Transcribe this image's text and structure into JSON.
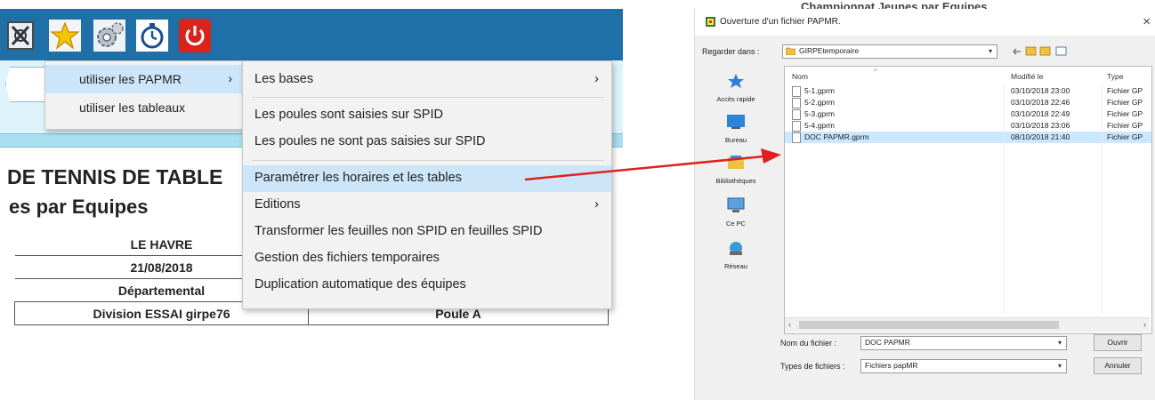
{
  "toolbar": {
    "buttons": [
      {
        "name": "close-x-icon"
      },
      {
        "name": "star-icon"
      },
      {
        "name": "gear-icon"
      },
      {
        "name": "stopwatch-icon"
      },
      {
        "name": "power-icon"
      }
    ],
    "color": "#1f6fa8"
  },
  "document": {
    "title_line1": "DE TENNIS DE TABLE",
    "title_line2": "es par Equipes",
    "rows": [
      {
        "left": "LE HAVRE",
        "right": ""
      },
      {
        "left": "21/08/2018",
        "right": ""
      },
      {
        "left": "Départemental",
        "right": ""
      },
      {
        "left": "Division  ESSAI girpe76",
        "right": "Poule A"
      }
    ]
  },
  "menu1": {
    "items": [
      {
        "label": "utiliser les PAPMR",
        "submenu": "›",
        "highlighted": true
      },
      {
        "label": "utiliser les tableaux",
        "submenu": "",
        "highlighted": false
      }
    ]
  },
  "menu2": {
    "items": [
      {
        "label": "Les bases",
        "submenu": "›"
      },
      {
        "label": "Les poules sont saisies sur SPID",
        "submenu": ""
      },
      {
        "label": "Les poules ne sont pas saisies sur SPID",
        "submenu": ""
      },
      {
        "label": "Paramétrer les horaires et les tables",
        "submenu": "",
        "highlighted": true
      },
      {
        "label": "Editions",
        "submenu": "›"
      },
      {
        "label": "Transformer les feuilles non SPID en feuilles SPID",
        "submenu": ""
      },
      {
        "label": "Gestion des fichiers temporaires",
        "submenu": ""
      },
      {
        "label": "Duplication automatique des équipes",
        "submenu": ""
      }
    ],
    "highlight_color": "#cce5f8"
  },
  "dialog": {
    "background_text": "Championnat  Jeunes par Equipes",
    "title": "Ouverture d'un fichier PAPMR.",
    "close_glyph": "×",
    "look_in_label": "Regarder dans :",
    "look_in_value": "GIRPEtemporaire",
    "places": [
      {
        "label": "Accès rapide",
        "icon": "star-icon"
      },
      {
        "label": "Bureau",
        "icon": "desktop-icon"
      },
      {
        "label": "Bibliothèques",
        "icon": "libraries-icon"
      },
      {
        "label": "Ce PC",
        "icon": "computer-icon"
      },
      {
        "label": "Réseau",
        "icon": "network-icon"
      }
    ],
    "columns": [
      "Nom",
      "Modifié le",
      "Type"
    ],
    "files": [
      {
        "name": "5-1.gprm",
        "modified": "03/10/2018 23:00",
        "type": "Fichier GP",
        "selected": false
      },
      {
        "name": "5-2.gprm",
        "modified": "03/10/2018 22:46",
        "type": "Fichier GP",
        "selected": false
      },
      {
        "name": "5-3.gprm",
        "modified": "03/10/2018 22:49",
        "type": "Fichier GP",
        "selected": false
      },
      {
        "name": "5-4.gprm",
        "modified": "03/10/2018 23:06",
        "type": "Fichier GP",
        "selected": false
      },
      {
        "name": "DOC PAPMR.gprm",
        "modified": "08/10/2018 21:40",
        "type": "Fichier GP",
        "selected": true
      }
    ],
    "filename_label": "Nom du fichier :",
    "filename_value": "DOC PAPMR",
    "filetype_label": "Types de fichiers :",
    "filetype_value": "Fichiers papMR",
    "open_button": "Ouvrir",
    "cancel_button": "Annuler"
  },
  "annotation": {
    "arrow_color": "#e02020"
  }
}
